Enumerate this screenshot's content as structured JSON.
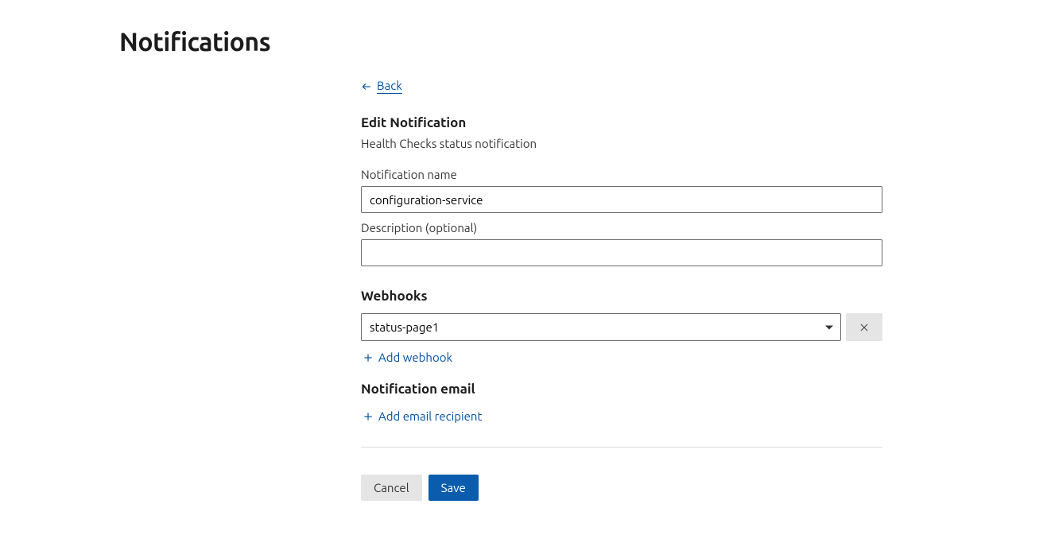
{
  "page": {
    "title": "Notifications"
  },
  "nav": {
    "back_label": "Back"
  },
  "form": {
    "heading": "Edit Notification",
    "subtitle": "Health Checks status notification",
    "name_label": "Notification name",
    "name_value": "configuration-service",
    "description_label": "Description (optional)",
    "description_value": ""
  },
  "webhooks": {
    "heading": "Webhooks",
    "selected": "status-page1",
    "add_label": "Add webhook"
  },
  "email": {
    "heading": "Notification email",
    "add_label": "Add email recipient"
  },
  "actions": {
    "cancel": "Cancel",
    "save": "Save"
  }
}
